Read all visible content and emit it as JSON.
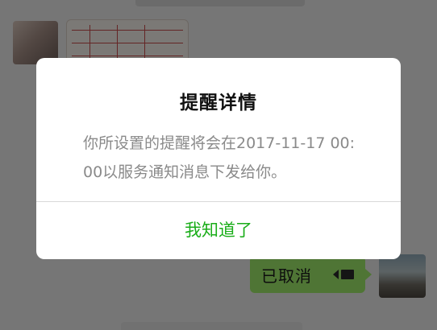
{
  "chat": {
    "voice_message_label": "已取消",
    "voice_icon": "voice-wave-icon"
  },
  "dialog": {
    "title": "提醒详情",
    "message": "你所设置的提醒将会在2017-11-17 00:00以服务通知消息下发给你。",
    "confirm_label": "我知道了"
  },
  "colors": {
    "accent_green": "#1aad19",
    "bubble_green": "#9eea6a",
    "message_gray": "#8a8a8a"
  }
}
